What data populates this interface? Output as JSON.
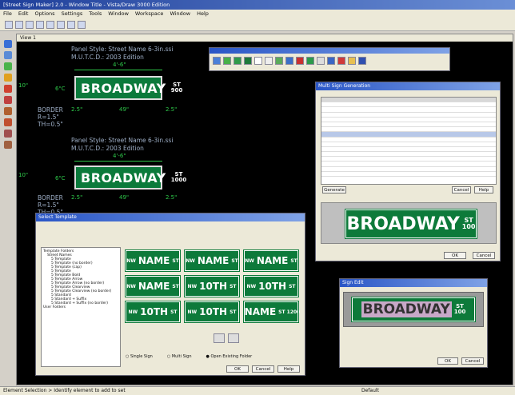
{
  "app": {
    "title": "[Street Sign Maker] 2.0 - Window Title - Vista/Draw 3000 Edition"
  },
  "menu": [
    "File",
    "Edit",
    "Options",
    "Settings",
    "Tools",
    "Window",
    "Workspace",
    "Window",
    "Help"
  ],
  "canvas": {
    "view_title": "View 1"
  },
  "sign1": {
    "panel_style": "Panel Style: Street Name 6-3in.ssi",
    "edition": "M.U.T.C.D.: 2003 Edition",
    "width": "4'-6\"",
    "name": "BROADWAY",
    "suffix": "ST",
    "number": "900",
    "border": "BORDER",
    "radius": "R=1.5\"",
    "th": "TH=0.5\"",
    "dim_l": "2.5\"",
    "dim_c": "49\"",
    "dim_r": "2.5\"",
    "height": "10\"",
    "inner": "6\"C"
  },
  "sign2": {
    "panel_style": "Panel Style: Street Name 6-3in.ssi",
    "edition": "M.U.T.C.D.: 2003 Edition",
    "width": "4'-6\"",
    "name": "BROADWAY",
    "suffix": "ST",
    "number": "1000",
    "border": "BORDER",
    "radius": "R=1.5\"",
    "th": "TH=0.5\"",
    "dim_l": "2.5\"",
    "dim_c": "49\"",
    "dim_r": "2.5\"",
    "height": "10\"",
    "inner": "6\"C"
  },
  "dialog_template": {
    "title": "Select Template",
    "tiles": [
      {
        "pre": "NW",
        "main": "NAME",
        "suf": "ST"
      },
      {
        "pre": "NW",
        "main": "NAME",
        "suf": "ST"
      },
      {
        "pre": "NW",
        "main": "NAME",
        "suf": "ST"
      },
      {
        "pre": "NW",
        "main": "NAME",
        "suf": "ST"
      },
      {
        "pre": "NW",
        "main": "10TH",
        "suf": "ST"
      },
      {
        "pre": "NW",
        "main": "10TH",
        "suf": "ST"
      },
      {
        "pre": "NW",
        "main": "10TH",
        "suf": "ST"
      },
      {
        "pre": "NW",
        "main": "10TH",
        "suf": "ST"
      },
      {
        "pre": "",
        "main": "NAME",
        "suf": "ST 1200"
      }
    ],
    "tree": [
      "Template Folders",
      "Street Names",
      "5 Template",
      "5 Template (no border)",
      "5 Template (cap)",
      "5 Template",
      "5 Template Bold",
      "5 Template Arrow",
      "5 Template Arrow (no border)",
      "5 Template Clearview",
      "5 Template Clearview (no border)",
      "5 Standard",
      "5 Standard + Suffix",
      "5 Standard + Suffix (no border)",
      "User Folders"
    ],
    "radio": [
      "Single Sign",
      "Multi Sign",
      "Open Existing Folder"
    ],
    "buttons": [
      "OK",
      "Cancel",
      "Help"
    ]
  },
  "dialog_grid": {
    "title": "Multi Sign Generation",
    "preview": {
      "name": "BROADWAY",
      "suffix": "ST",
      "number": "100"
    },
    "buttons": [
      "Generate",
      "Cancel",
      "Help"
    ]
  },
  "dialog_small": {
    "title": "Sign Edit",
    "preview": {
      "name": "BROADWAY",
      "suffix": "ST",
      "number": "100"
    },
    "buttons": [
      "OK",
      "Cancel"
    ]
  },
  "status": {
    "left": "Element Selection > Identify element to add to set",
    "right": "Default"
  },
  "colors": {
    "sign_green": "#0d7a3a",
    "cad_green": "#2ec94a"
  }
}
